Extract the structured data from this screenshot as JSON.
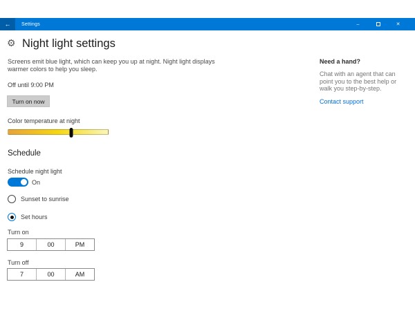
{
  "colors": {
    "accent": "#0078d7",
    "button_bg": "#cccccc",
    "link": "#0070d6",
    "slider_gradient": [
      "#e8a33c",
      "#f6d713",
      "#faf6bb"
    ]
  },
  "titlebar": {
    "back_icon": "←",
    "title": "Settings",
    "minimize_icon": "–",
    "close_icon": "✕"
  },
  "page": {
    "title": "Night light settings",
    "description": "Screens emit blue light, which can keep you up at night. Night light displays warmer colors to help you sleep.",
    "status": "Off until 9:00 PM",
    "turn_on_button": "Turn on now",
    "slider_label": "Color temperature at night",
    "slider_value_percent": 63
  },
  "schedule": {
    "heading": "Schedule",
    "toggle_label": "Schedule night light",
    "toggle_on": true,
    "toggle_state_label": "On",
    "options": [
      {
        "label": "Sunset to sunrise",
        "selected": false
      },
      {
        "label": "Set hours",
        "selected": true
      }
    ],
    "turn_on": {
      "label": "Turn on",
      "hour": "9",
      "minute": "00",
      "period": "PM"
    },
    "turn_off": {
      "label": "Turn off",
      "hour": "7",
      "minute": "00",
      "period": "AM"
    }
  },
  "help": {
    "title": "Need a hand?",
    "body": "Chat with an agent that can point you to the best help or walk you step-by-step.",
    "link": "Contact support"
  }
}
